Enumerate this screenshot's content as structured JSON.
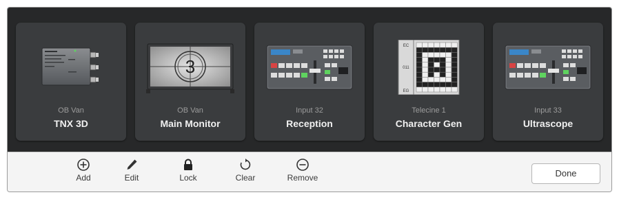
{
  "devices": [
    {
      "subtitle": "OB Van",
      "name": "TNX 3D",
      "icon": "converter-box-icon"
    },
    {
      "subtitle": "OB Van",
      "name": "Main Monitor",
      "icon": "countdown-monitor-icon"
    },
    {
      "subtitle": "Input 32",
      "name": "Reception",
      "icon": "switcher-panel-icon"
    },
    {
      "subtitle": "Telecine 1",
      "name": "Character Gen",
      "icon": "character-grid-icon"
    },
    {
      "subtitle": "Input 33",
      "name": "Ultrascope",
      "icon": "switcher-panel-icon"
    }
  ],
  "monitor_countdown": "3",
  "chargrid_labels": {
    "top": "EC",
    "mid": "011",
    "bot": "EG"
  },
  "toolbar": {
    "add_label": "Add",
    "edit_label": "Edit",
    "lock_label": "Lock",
    "clear_label": "Clear",
    "remove_label": "Remove"
  },
  "done_label": "Done",
  "colors": {
    "panel_bg": "#272829",
    "card_bg": "#3a3c3e",
    "toolbar_bg": "#f4f4f4"
  }
}
